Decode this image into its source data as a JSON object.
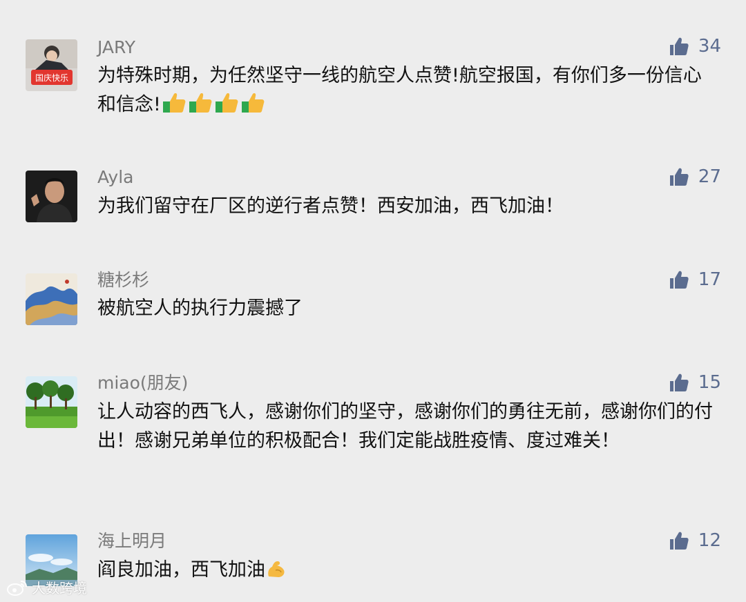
{
  "comments": [
    {
      "username": "JARY",
      "likes": "34",
      "text": "为特殊时期，为任然坚守一线的航空人点赞!航空报国，有你们多一份信心和信念!",
      "emoji": [
        "thumbs-up",
        "thumbs-up",
        "thumbs-up",
        "thumbs-up"
      ],
      "avatar_label": "国庆快乐"
    },
    {
      "username": "Ayla",
      "likes": "27",
      "text": "为我们留守在厂区的逆行者点赞！西安加油，西飞加油！"
    },
    {
      "username": "糖杉杉",
      "likes": "17",
      "text": "被航空人的执行力震撼了"
    },
    {
      "username": "miao(朋友)",
      "likes": "15",
      "text": "让人动容的西飞人，感谢你们的坚守，感谢你们的勇往无前，感谢你们的付出！感谢兄弟单位的积极配合！我们定能战胜疫情、度过难关！"
    },
    {
      "username": "海上明月",
      "likes": "12",
      "text": "阎良加油，西飞加油",
      "emoji": [
        "flexed-biceps"
      ]
    }
  ],
  "watermark": {
    "text": "大数跨境",
    "icon": "weibo-logo-icon"
  },
  "colors": {
    "background": "#ededed",
    "username": "#7a7a7a",
    "like_accent": "#5b6c8f",
    "comment_text": "#111111"
  },
  "icons": {
    "like": "thumbs-up-icon"
  }
}
